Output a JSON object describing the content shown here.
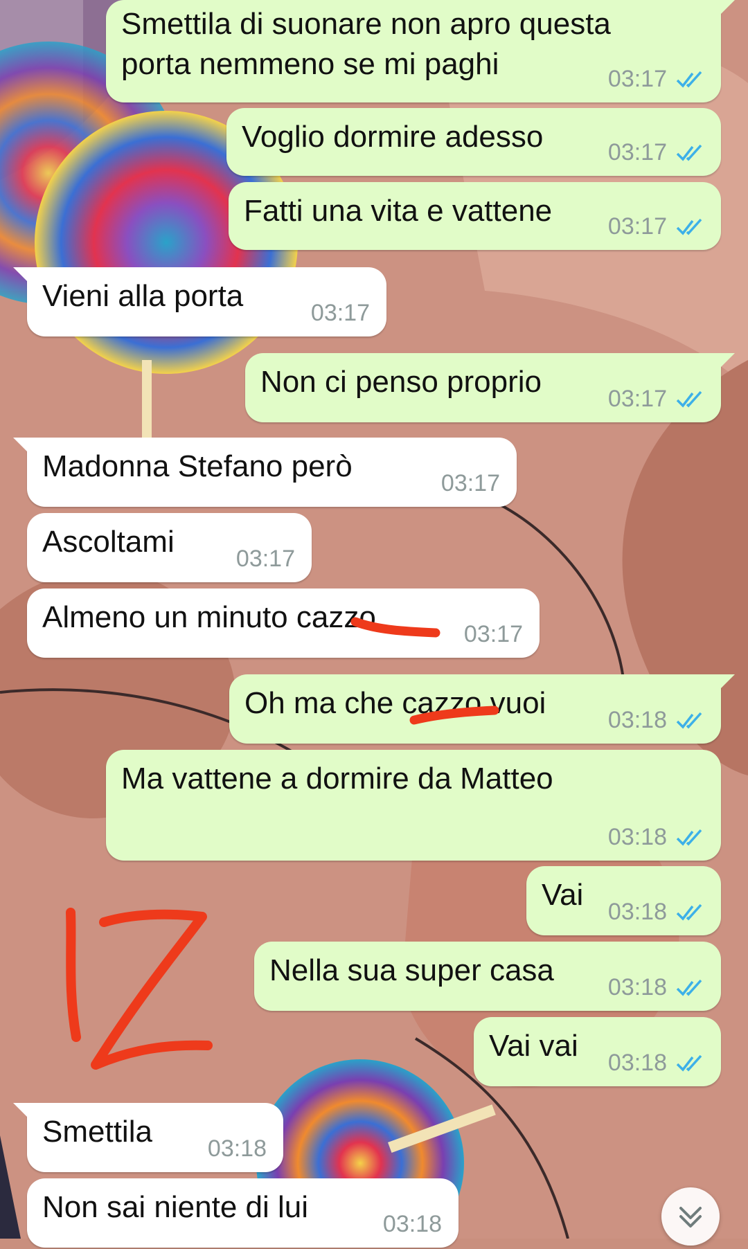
{
  "messages": [
    {
      "dir": "out",
      "text": "Smettila di suonare non apro questa\nporta nemmeno se mi paghi",
      "time": "03:17",
      "read": true
    },
    {
      "dir": "out",
      "text": "Voglio dormire adesso",
      "time": "03:17",
      "read": true
    },
    {
      "dir": "out",
      "text": "Fatti una vita e vattene",
      "time": "03:17",
      "read": true
    },
    {
      "dir": "in",
      "text": "Vieni alla porta",
      "time": "03:17"
    },
    {
      "dir": "out",
      "text": "Non ci penso proprio",
      "time": "03:17",
      "read": true
    },
    {
      "dir": "in",
      "text": "Madonna Stefano però",
      "time": "03:17"
    },
    {
      "dir": "in",
      "text": "Ascoltami",
      "time": "03:17"
    },
    {
      "dir": "in",
      "text": "Almeno un minuto cazzo",
      "time": "03:17"
    },
    {
      "dir": "out",
      "text": "Oh ma che cazzo vuoi",
      "time": "03:18",
      "read": true
    },
    {
      "dir": "out",
      "text": "Ma vattene a dormire da Matteo",
      "time": "03:18",
      "read": true
    },
    {
      "dir": "out",
      "text": "Vai",
      "time": "03:18",
      "read": true
    },
    {
      "dir": "out",
      "text": "Nella sua super casa",
      "time": "03:18",
      "read": true
    },
    {
      "dir": "out",
      "text": "Vai vai",
      "time": "03:18",
      "read": true
    },
    {
      "dir": "in",
      "text": "Smettila",
      "time": "03:18"
    },
    {
      "dir": "in",
      "text": "Non sai niente di lui",
      "time": "03:18"
    }
  ],
  "annotation": {
    "text": "12",
    "color": "#ee3a1b"
  },
  "colors": {
    "outgoing": "#e1fcc8",
    "incoming": "#ffffff",
    "read_ticks": "#3db0e8",
    "time": "#8e9a9a"
  },
  "scroll_button": {
    "icon": "chevron-double-down-icon"
  }
}
